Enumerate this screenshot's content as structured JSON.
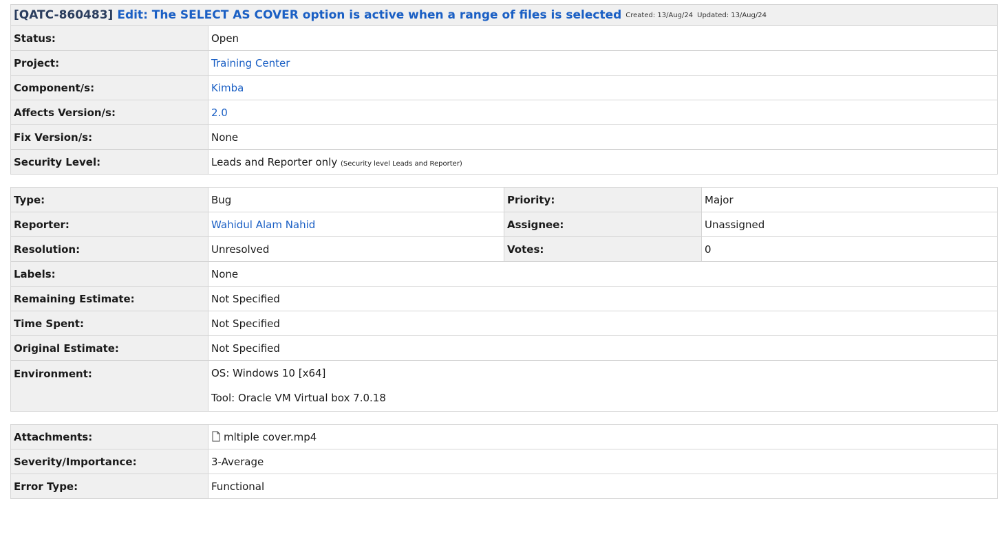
{
  "issue": {
    "key": "[QATC-860483]",
    "title": "Edit: The SELECT AS COVER option is active when a range of files is selected",
    "created": "Created: 13/Aug/24",
    "updated": "Updated: 13/Aug/24"
  },
  "details": {
    "status_label": "Status:",
    "status": "Open",
    "project_label": "Project:",
    "project": "Training Center",
    "component_label": "Component/s:",
    "component": "Kimba",
    "affects_label": "Affects Version/s:",
    "affects": "2.0",
    "fix_label": "Fix Version/s:",
    "fix": "None",
    "security_label": "Security Level:",
    "security": "Leads and Reporter only",
    "security_note": "(Security level Leads and Reporter)"
  },
  "people": {
    "type_label": "Type:",
    "type": "Bug",
    "priority_label": "Priority:",
    "priority": "Major",
    "reporter_label": "Reporter:",
    "reporter": "Wahidul Alam Nahid",
    "assignee_label": "Assignee:",
    "assignee": "Unassigned",
    "resolution_label": "Resolution:",
    "resolution": "Unresolved",
    "votes_label": "Votes:",
    "votes": "0",
    "labels_label": "Labels:",
    "labels": "None",
    "remaining_label": "Remaining Estimate:",
    "remaining": "Not Specified",
    "spent_label": "Time Spent:",
    "spent": "Not Specified",
    "original_label": "Original Estimate:",
    "original": "Not Specified",
    "environment_label": "Environment:",
    "environment_os": "OS: Windows 10 [x64]",
    "environment_tool": "Tool: Oracle VM Virtual  box 7.0.18"
  },
  "extra": {
    "attachments_label": "Attachments:",
    "attachment_icon": "file-icon",
    "attachment": "mltiple cover.mp4",
    "severity_label": "Severity/Importance:",
    "severity": "3-Average",
    "error_label": "Error Type:",
    "error": "Functional"
  }
}
